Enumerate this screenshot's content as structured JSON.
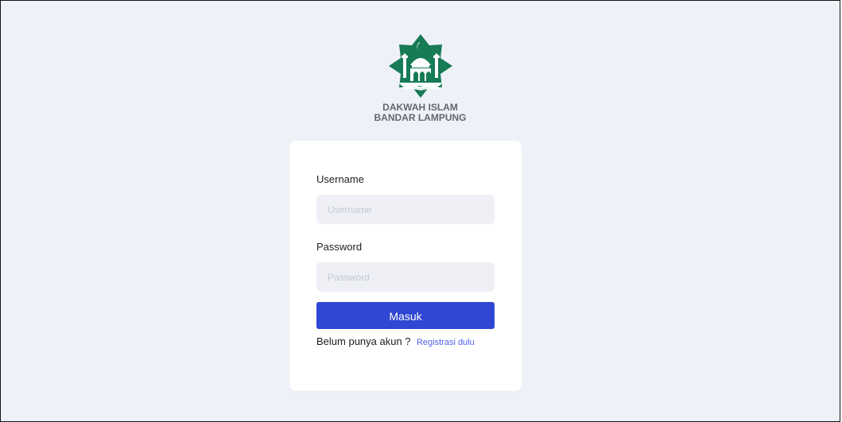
{
  "brand": {
    "line1": "DAKWAH ISLAM",
    "line2": "BANDAR LAMPUNG",
    "logo_icon": "mosque-logo-icon",
    "colors": {
      "green": "#177b56",
      "white": "#ffffff"
    }
  },
  "login_form": {
    "username_label": "Username",
    "username_value": "",
    "username_placeholder": "Username",
    "password_label": "Password",
    "password_value": "",
    "password_placeholder": "Password",
    "submit_label": "Masuk",
    "register_prompt": "Belum punya akun ?",
    "register_link": "Registrasi dulu"
  },
  "theme": {
    "background": "#eef1f8",
    "card": "#ffffff",
    "primary_button": "#2f47d2",
    "link": "#5163ea",
    "input_background": "#eef0f5"
  }
}
